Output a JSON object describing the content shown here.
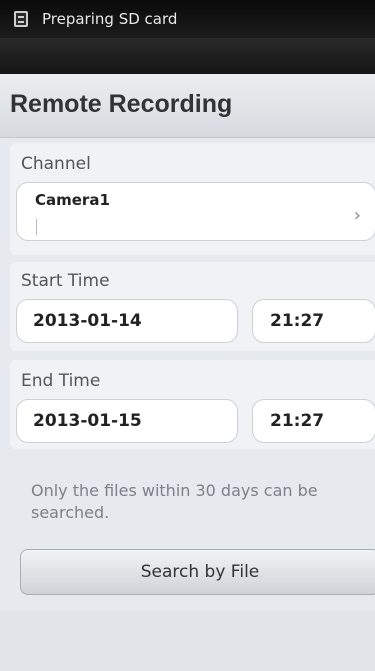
{
  "status_bar": {
    "icon": "sd-card-icon",
    "text": "Preparing SD card"
  },
  "header": {
    "title": "Remote Recording"
  },
  "channel": {
    "label": "Channel",
    "value": "Camera1"
  },
  "start_time": {
    "label": "Start Time",
    "date": "2013-01-14",
    "time": "21:27"
  },
  "end_time": {
    "label": "End Time",
    "date": "2013-01-15",
    "time": "21:27"
  },
  "hint": "Only the files within 30 days can be searched.",
  "search_button": "Search by File"
}
